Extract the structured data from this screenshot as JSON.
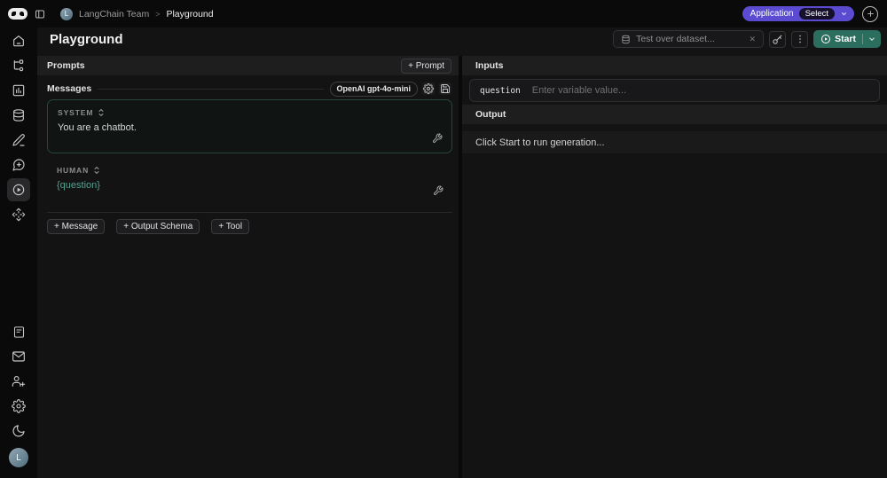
{
  "topbar": {
    "team_initial": "L",
    "team_name": "LangChain Team",
    "breadcrumb_separator": ">",
    "page_name": "Playground",
    "application_label": "Application",
    "application_value": "Select"
  },
  "page": {
    "title": "Playground"
  },
  "toolbar": {
    "dataset_placeholder": "Test over dataset...",
    "close_x": "✕",
    "start_label": "Start"
  },
  "sidebar": {
    "icons_top": [
      "home-icon",
      "trace-tree-icon",
      "dashboard-icon",
      "datasets-icon",
      "prompts-pencil-icon",
      "annotation-chat-icon",
      "playground-play-icon",
      "deployments-move-icon"
    ],
    "icons_bottom": [
      "docs-file-icon",
      "mail-icon",
      "invite-user-icon",
      "settings-gear-icon",
      "dark-mode-moon-icon"
    ],
    "active": "playground-play-icon",
    "avatar_initial": "L"
  },
  "prompts": {
    "header": "Prompts",
    "add_prompt_label": "+ Prompt",
    "messages_header": "Messages",
    "model_label": "OpenAI gpt-4o-mini",
    "messages": [
      {
        "role": "SYSTEM",
        "content": "You are a chatbot."
      },
      {
        "role": "HUMAN",
        "content": "{question}"
      }
    ],
    "add_message_label": "+ Message",
    "add_output_schema_label": "+ Output Schema",
    "add_tool_label": "+ Tool"
  },
  "inputs": {
    "header": "Inputs",
    "variables": [
      {
        "name": "question",
        "placeholder": "Enter variable value..."
      }
    ]
  },
  "output": {
    "header": "Output",
    "empty_message": "Click Start to run generation..."
  },
  "colors": {
    "accent_purple": "#5a4bd0",
    "accent_teal_text": "#54a28e",
    "start_button_green": "#2b6e5d",
    "selected_message_border": "#28453e"
  }
}
